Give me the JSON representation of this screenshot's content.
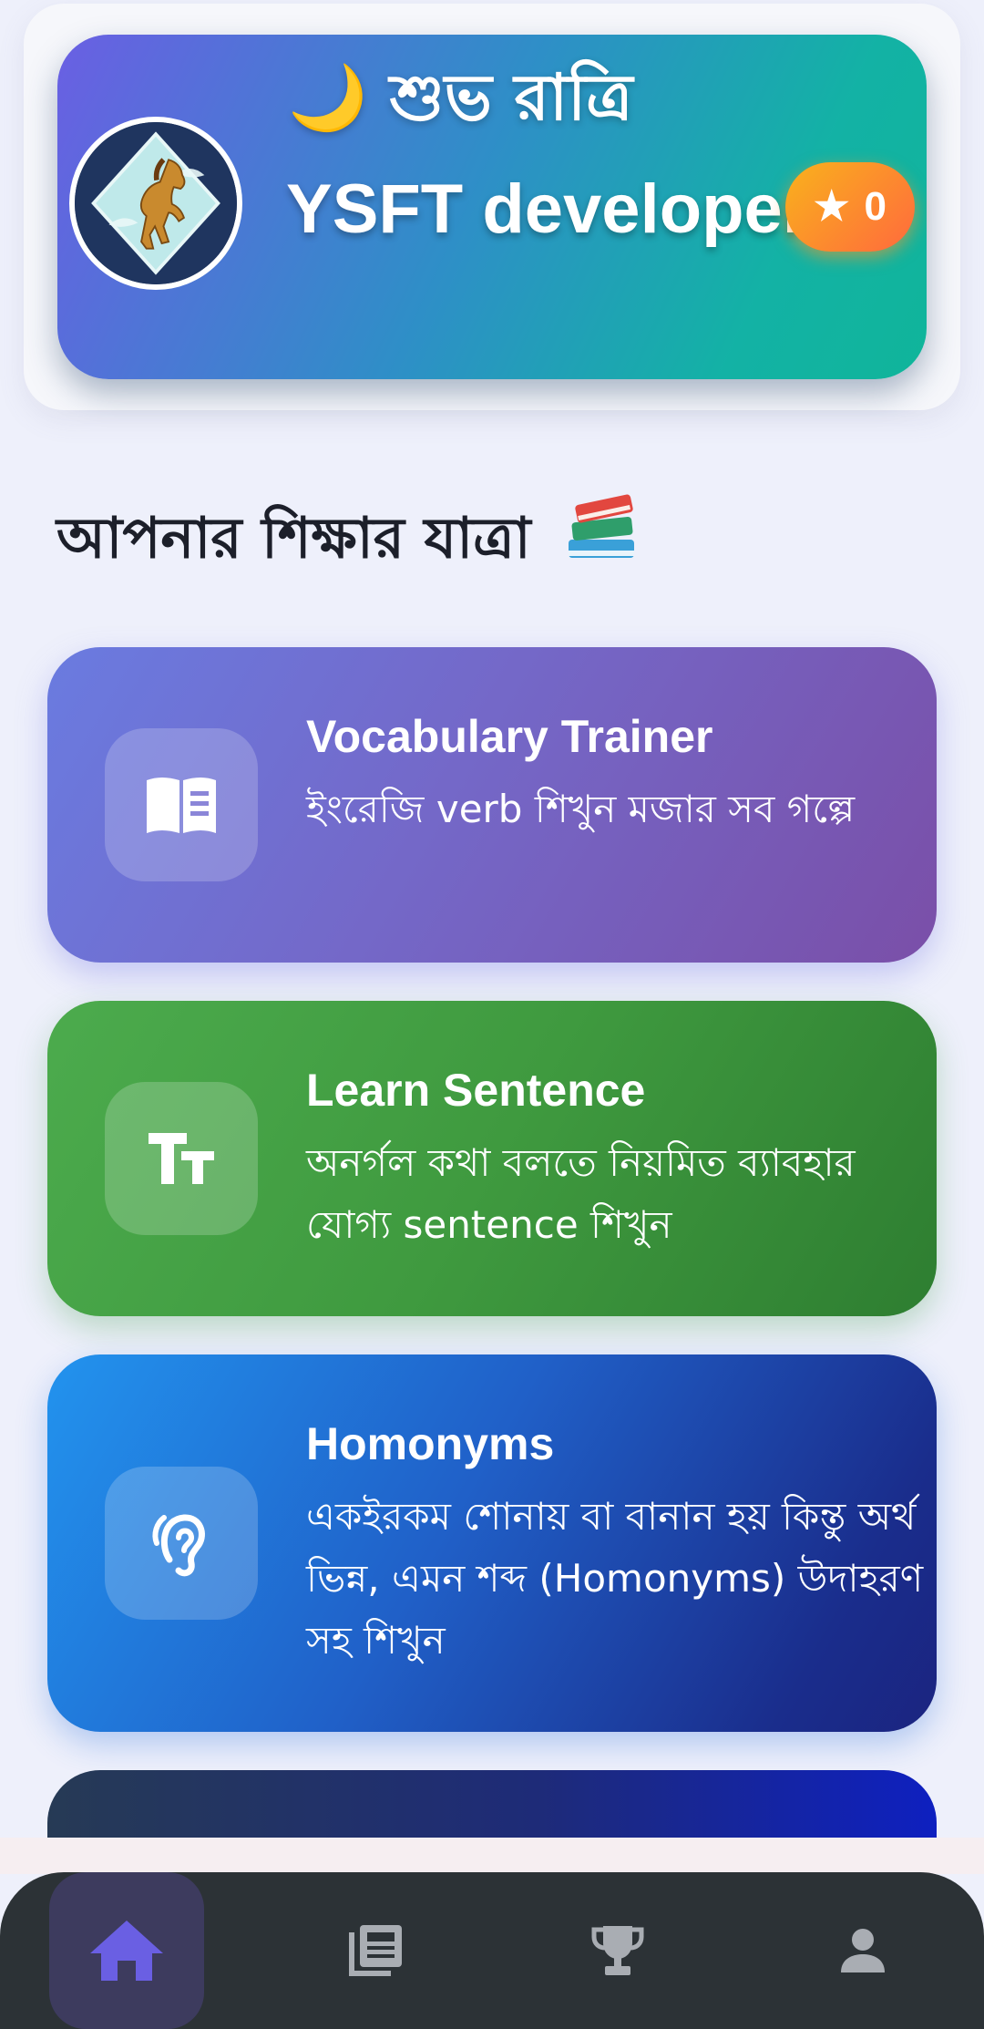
{
  "header": {
    "greeting": "🌙 শুভ রাত্রি",
    "username": "YSFT developer",
    "points": "0",
    "points_icon": "star-icon",
    "avatar_icon": "horse-avatar-icon"
  },
  "section": {
    "title": "আপনার শিক্ষার যাত্রা",
    "emoji": "books-icon"
  },
  "cards": [
    {
      "title": "Vocabulary Trainer",
      "description": "ইংরেজি verb শিখুন মজার সব গল্পে",
      "icon": "book-open-icon",
      "color": "#7468c8"
    },
    {
      "title": "Learn Sentence",
      "description": "অনর্গল কথা বলতে নিয়মিত ব্যাবহার যোগ্য sentence শিখুন",
      "icon": "text-size-icon",
      "color": "#3f9a3f"
    },
    {
      "title": "Homonyms",
      "description": "একইরকম শোনায় বা বানান হয় কিন্তু অর্থ ভিন্ন, এমন শব্দ (Homonyms) উদাহরণ সহ শিখুন",
      "icon": "ear-icon",
      "color": "#2060c8"
    }
  ],
  "nav": {
    "items": [
      {
        "name": "home",
        "icon": "home-icon",
        "active": true
      },
      {
        "name": "lessons",
        "icon": "newspaper-icon",
        "active": false
      },
      {
        "name": "leaderboard",
        "icon": "trophy-icon",
        "active": false
      },
      {
        "name": "profile",
        "icon": "person-icon",
        "active": false
      }
    ],
    "active_color": "#6a5fe3",
    "inactive_color": "#a9adb3"
  }
}
